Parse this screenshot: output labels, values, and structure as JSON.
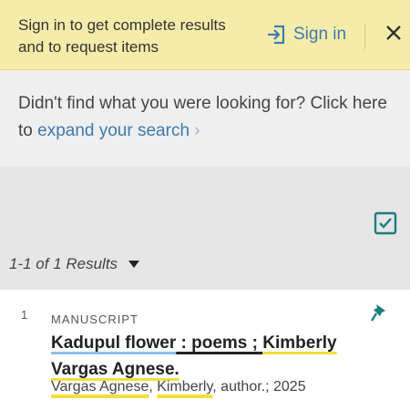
{
  "banner": {
    "message": "Sign in to get complete results and to request items",
    "signin_label": "Sign in"
  },
  "expand": {
    "prefix": "Didn't find what you were looking for? Click here to ",
    "link_label": "expand your search",
    "chevron": "›"
  },
  "results": {
    "count_text": "1-1 of 1 Results"
  },
  "record": {
    "number": "1",
    "type": "MANUSCRIPT",
    "title_part1": "Kadupul flower",
    "title_sep": " : poems ; ",
    "title_part2": "Kimberly Vargas Agnese.",
    "author_name1": "Vargas Agnese",
    "author_comma": ", ",
    "author_name2": "Kimberly",
    "author_rest": ", author.; 2025"
  },
  "colors": {
    "banner_bg": "#f6ecaa",
    "link": "#3d7bb0",
    "accent_teal": "#1d7d80",
    "highlight_yellow": "#f2df3c",
    "highlight_blue": "#8ec0ec"
  },
  "icons": {
    "signin": "sign-in-icon",
    "close": "close-icon",
    "check": "checkbox-icon",
    "pin": "pin-icon"
  }
}
